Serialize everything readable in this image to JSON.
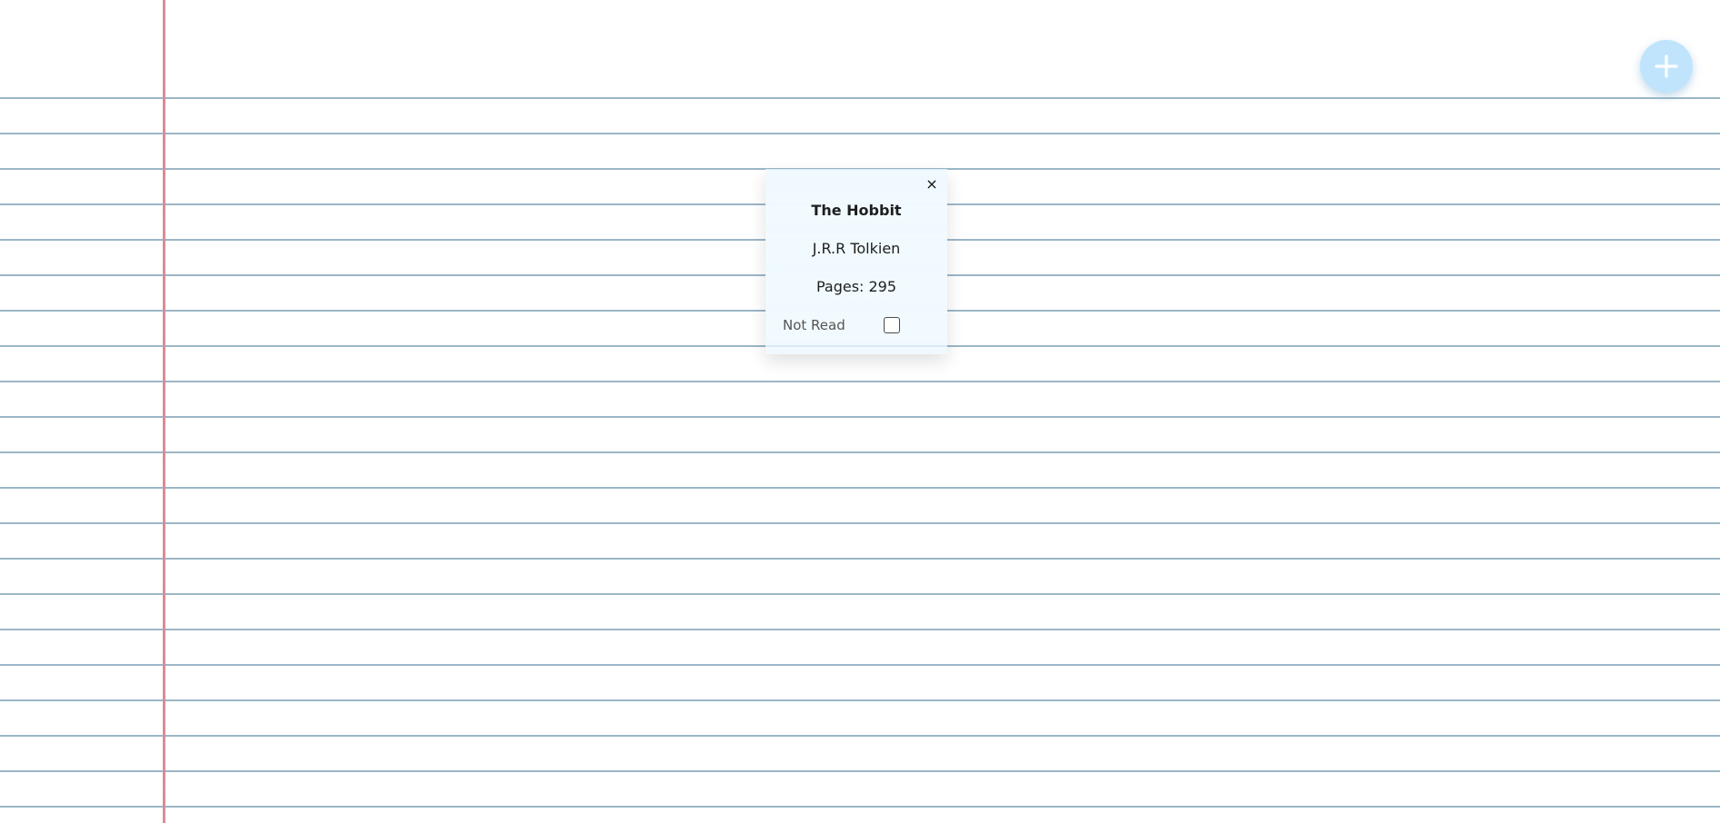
{
  "app": {
    "add_button_icon": "plus-icon",
    "accent_color": "#bfe4fb",
    "margin_color": "#d98d99",
    "rule_color": "#9bb7c7"
  },
  "card": {
    "title": "The Hobbit",
    "author": "J.R.R Tolkien",
    "pages": "Pages: 295",
    "read_status": "Not Read",
    "read_checked": false,
    "close_icon": "close-icon",
    "close_symbol": "×"
  }
}
